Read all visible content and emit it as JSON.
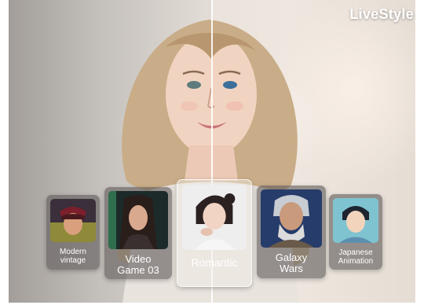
{
  "brand": "LiveStyle",
  "styles": [
    {
      "label_line1": "Modern",
      "label_line2": "vintage",
      "selected": false
    },
    {
      "label_line1": "Video",
      "label_line2": "Game 03",
      "selected": false
    },
    {
      "label_line1": "Romantic",
      "label_line2": "",
      "selected": true
    },
    {
      "label_line1": "Galaxy",
      "label_line2": "Wars",
      "selected": false
    },
    {
      "label_line1": "Japanese",
      "label_line2": "Animation",
      "selected": false
    }
  ]
}
